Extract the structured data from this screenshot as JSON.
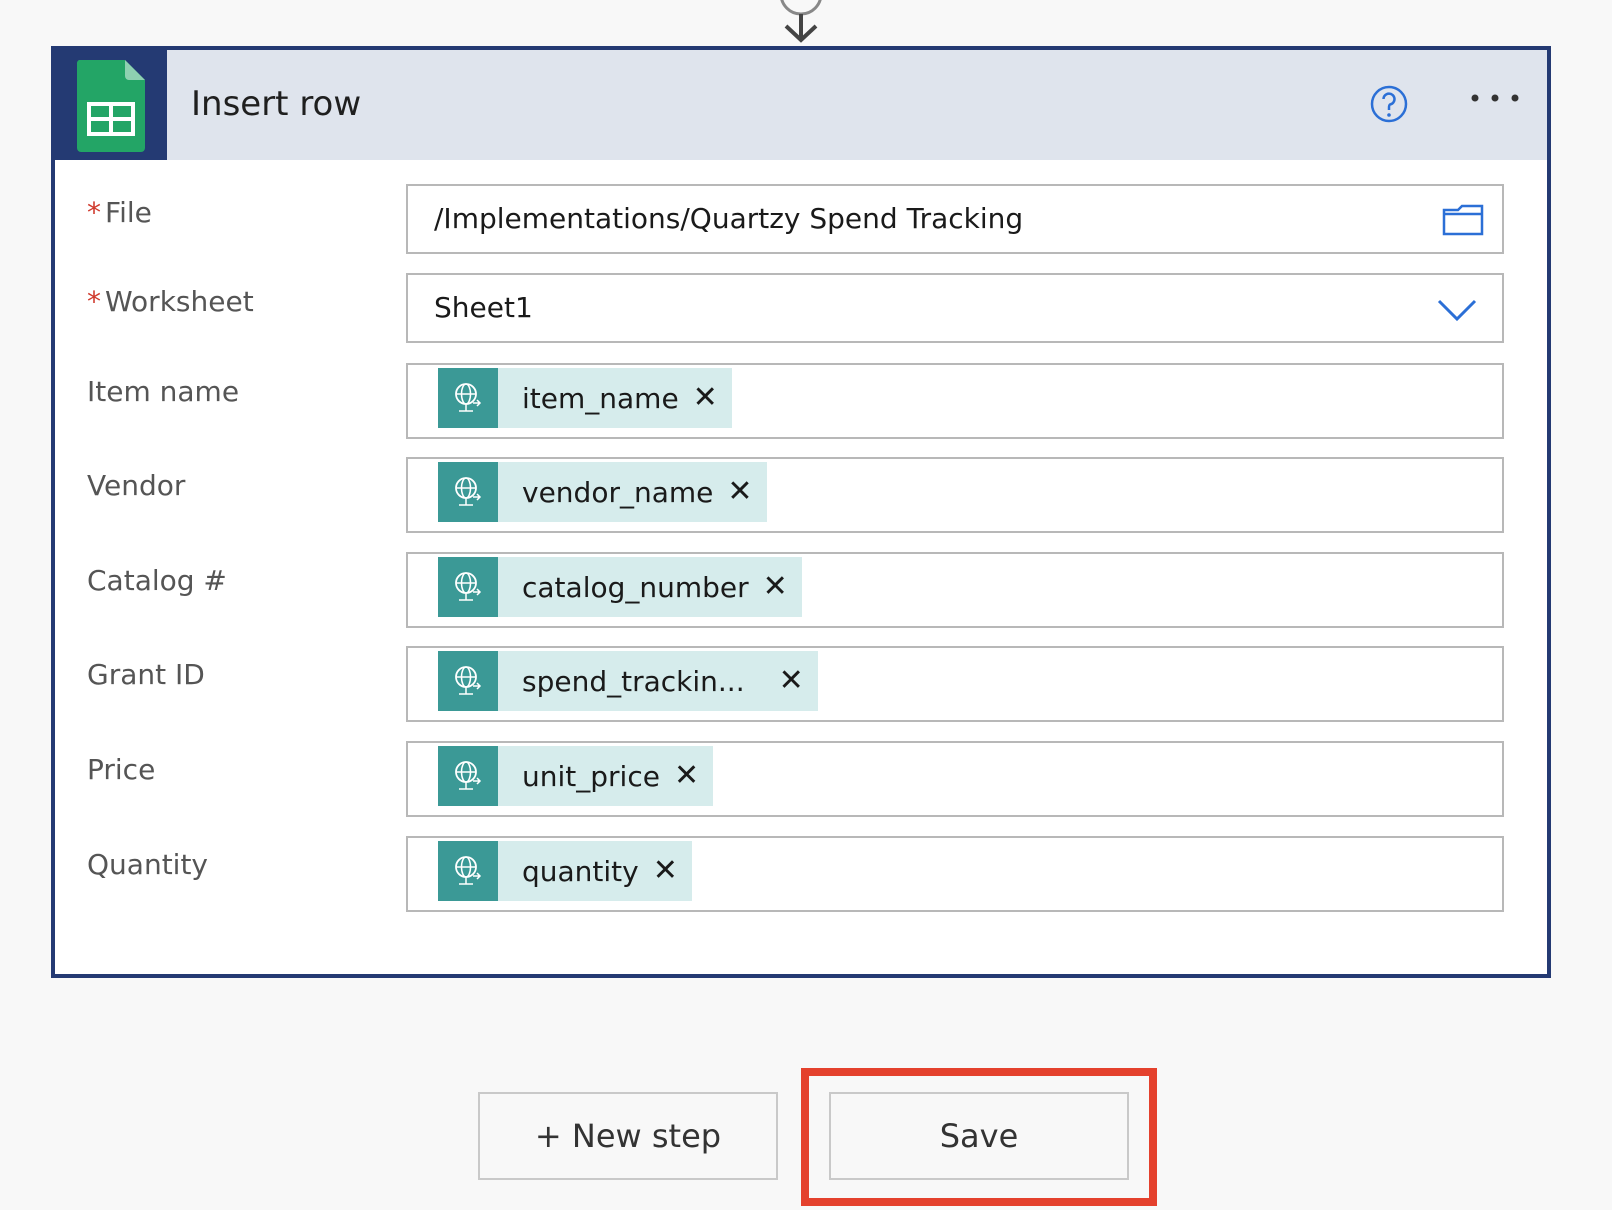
{
  "card": {
    "title": "Insert row",
    "app_icon": "google-sheets-icon"
  },
  "fields": {
    "file": {
      "label": "File",
      "required_mark": "*",
      "value": "/Implementations/Quartzy Spend Tracking"
    },
    "worksheet": {
      "label": "Worksheet",
      "required_mark": "*",
      "value": "Sheet1"
    },
    "item_name": {
      "label": "Item name",
      "token": "item_name"
    },
    "vendor": {
      "label": "Vendor",
      "token": "vendor_name"
    },
    "catalog": {
      "label": "Catalog #",
      "token": "catalog_number"
    },
    "grant_id": {
      "label": "Grant ID",
      "token": "spend_trackin..."
    },
    "price": {
      "label": "Price",
      "token": "unit_price"
    },
    "quantity": {
      "label": "Quantity",
      "token": "quantity"
    }
  },
  "token_close_glyph": "✕",
  "buttons": {
    "new_step": "+ New step",
    "save": "Save"
  },
  "colors": {
    "header_bg": "#dfe4ed",
    "card_border": "#243a73",
    "token_bg": "#d6ecec",
    "token_icon_bg": "#3b9996",
    "highlight": "#e4412d",
    "accent_blue": "#2b6fd6"
  }
}
